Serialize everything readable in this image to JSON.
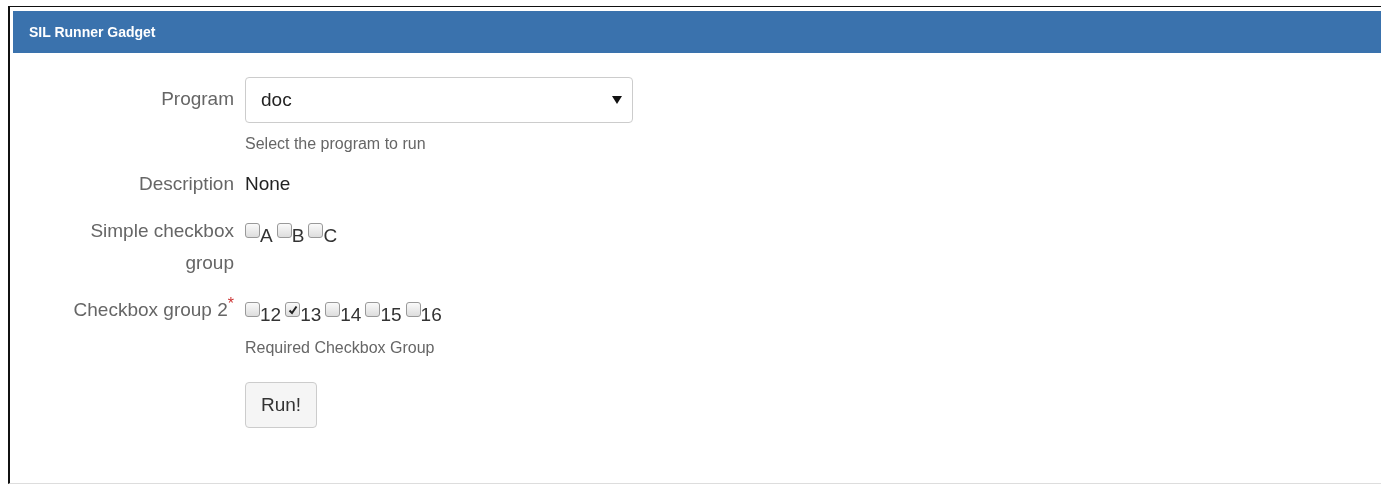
{
  "panel": {
    "title": "SIL Runner Gadget"
  },
  "fields": [
    {
      "kind": "select",
      "label": "Program",
      "value": "doc",
      "help": "Select the program to run"
    },
    {
      "kind": "text",
      "label": "Description",
      "value": "None"
    },
    {
      "kind": "checkboxes",
      "label": "Simple checkbox group",
      "options": [
        {
          "label": "A",
          "checked": false
        },
        {
          "label": "B",
          "checked": false
        },
        {
          "label": "C",
          "checked": false
        }
      ]
    },
    {
      "kind": "checkboxes",
      "label": "Checkbox group 2",
      "required_mark": "*",
      "help": "Required Checkbox Group",
      "options": [
        {
          "label": "12",
          "checked": false
        },
        {
          "label": "13",
          "checked": true
        },
        {
          "label": "14",
          "checked": false
        },
        {
          "label": "15",
          "checked": false
        },
        {
          "label": "16",
          "checked": false
        }
      ]
    }
  ],
  "button": {
    "label": "Run!"
  }
}
